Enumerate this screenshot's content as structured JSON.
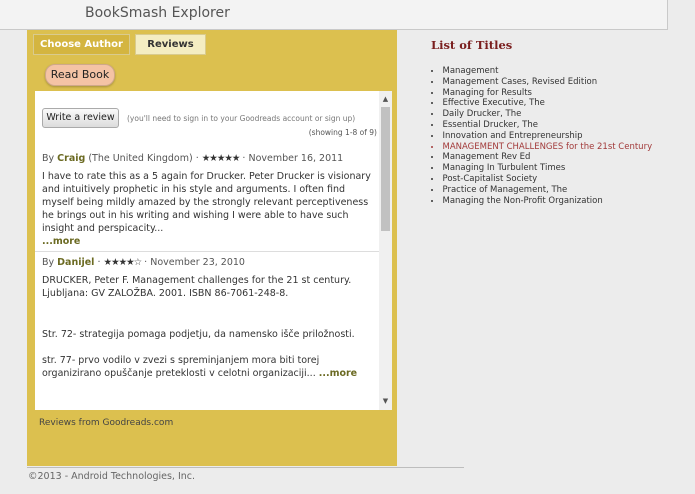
{
  "app": {
    "title": "BookSmash Explorer"
  },
  "tabs": [
    {
      "label": "Choose Author",
      "active": false
    },
    {
      "label": "Reviews",
      "active": true
    }
  ],
  "read_book_label": "Read Book",
  "reviews": {
    "write_review_label": "Write a review",
    "sign_in_note": "(you'll need to sign in to your Goodreads account or sign up)",
    "showing": "(showing 1-8 of 9)",
    "items": [
      {
        "by": "By",
        "reviewer": "Craig",
        "location": "(The United Kingdom)",
        "stars": "★★★★★",
        "date": "November 16, 2011",
        "paragraphs": [
          "I have to rate this as a 5 again for Drucker. Peter Drucker is visionary and intuitively prophetic in his style and arguments. I often find myself being mildly amazed by the strongly relevant perceptiveness he brings out in his writing and wishing I were able to have such insight and perspicacity..."
        ],
        "more": "...more"
      },
      {
        "by": "By",
        "reviewer": "Danijel",
        "location": "",
        "stars": "★★★★☆",
        "date": "November 23, 2010",
        "paragraphs": [
          "DRUCKER, Peter F. Management challenges for the 21 st century. Ljubljana: GV ZALOŽBA. 2001. ISBN 86-7061-248-8.",
          "Str. 72- strategija pomaga podjetju, da namensko išče priložnosti.",
          "str. 77- prvo vodilo v zvezi s spreminjanjem mora biti torej organizirano opuščanje preteklosti v celotni organizaciji..."
        ],
        "more": "...more"
      }
    ],
    "source": "Reviews from Goodreads.com",
    "scroll_up": "▲",
    "scroll_down": "▼"
  },
  "titles": {
    "heading": "List of Titles",
    "items": [
      "Management",
      "Management Cases, Revised Edition",
      "Managing for Results",
      "Effective Executive, The",
      "Daily Drucker, The",
      "Essential Drucker, The",
      "Innovation and Entrepreneurship",
      "MANAGEMENT CHALLENGES for the 21st Century",
      "Management Rev Ed",
      "Managing In Turbulent Times",
      "Post-Capitalist Society",
      "Practice of Management, The",
      "Managing the Non-Profit Organization"
    ],
    "active_title": "MANAGEMENT CHALLENGES for the 21st Century"
  },
  "footer": "©2013 - Android Technologies, Inc.",
  "colors": {
    "panel": "#dcc04f",
    "accent": "#7a1e1e",
    "link": "#6b6a22",
    "active_title": "#a23a3a"
  }
}
